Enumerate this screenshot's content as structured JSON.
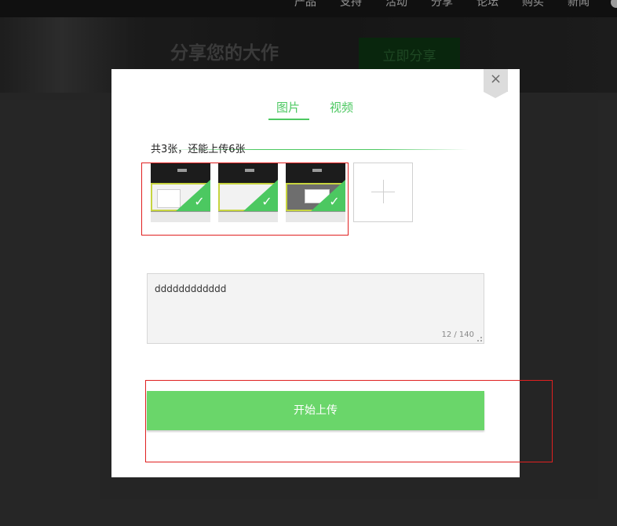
{
  "topnav": {
    "items": [
      "产品",
      "支持",
      "活动",
      "分享",
      "论坛",
      "购买",
      "新闻"
    ]
  },
  "banner": {
    "title": "分享您的大作",
    "subtitle": "",
    "cta_label": "立即分享"
  },
  "modal": {
    "close_symbol": "×",
    "tabs": [
      {
        "label": "图片",
        "active": true
      },
      {
        "label": "视频",
        "active": false
      }
    ],
    "upload_status": "共3张，还能上传6张",
    "thumbnails": [
      {
        "selected": true,
        "check_symbol": "✓"
      },
      {
        "selected": true,
        "check_symbol": "✓"
      },
      {
        "selected": true,
        "check_symbol": "✓"
      }
    ],
    "description": {
      "value": "dddddddddddd",
      "counter": "12 / 140"
    },
    "submit_label": "开始上传"
  },
  "colors": {
    "accent": "#4cc861",
    "button": "#6ad66a",
    "annotation_box": "#e02020"
  },
  "icons": [
    "close-icon",
    "check-icon",
    "plus-icon",
    "resize-icon"
  ]
}
